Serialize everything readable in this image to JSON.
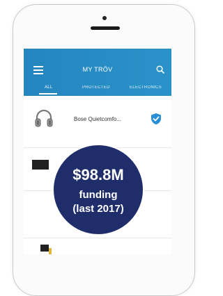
{
  "app": {
    "title": "MY TRÖV",
    "tabs": [
      {
        "label": "ALL",
        "active": true
      },
      {
        "label": "PROTECTED",
        "active": false
      },
      {
        "label": "ELECTRONICS",
        "active": false
      }
    ],
    "items": [
      {
        "name": "Bose Quietcomfo...",
        "icon": "headphones-icon",
        "status_icon": "shield-check-icon"
      }
    ],
    "colors": {
      "appbar": "#2585bf",
      "shield": "#2a8fd6",
      "badge": "#1f2e6b"
    }
  },
  "badge": {
    "amount": "$98.8M",
    "line1": "funding",
    "line2": "(last 2017)"
  }
}
